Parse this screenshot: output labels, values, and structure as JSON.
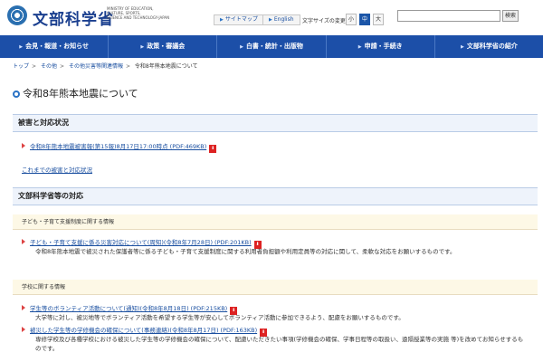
{
  "header": {
    "logo_text": "文部科学省",
    "logo_sub": [
      "MINISTRY OF EDUCATION,",
      "CULTURE, SPORTS,",
      "SCIENCE AND TECHNOLOGY-JAPAN"
    ],
    "sitemap_label": "サイトマップ",
    "english_label": "English",
    "font_size_label": "文字サイズの変更",
    "font_small": "小",
    "font_medium": "中",
    "font_large": "大",
    "search_placeholder": "",
    "search_button": "検索"
  },
  "nav": {
    "items": [
      "会見・報道・お知らせ",
      "政策・審議会",
      "白書・統計・出版物",
      "申請・手続き",
      "文部科学省の紹介"
    ]
  },
  "breadcrumb": {
    "items": [
      "トップ",
      "その他",
      "その他災害等関連情報",
      "令和8年熊本地震について"
    ]
  },
  "page": {
    "title": "令和8年熊本地震について",
    "section1": {
      "title": "被害と対応状況",
      "link1": "令和8年熊本地震被害報(第15報)8月17日17:00時点 (PDF:469KB)",
      "link2": "これまでの被害と対応状況"
    },
    "section2": {
      "title": "文部科学省等の対応",
      "sub1": {
        "title": "子ども・子育て支援制度に関する情報",
        "link": "子ども・子育て支援に係る災害対応について(周知)(令和8年7月28日) (PDF:201KB)",
        "desc": "令和8年熊本地震で被災された保護者等に係る子ども・子育て支援制度に関する利用者負担額や利用定員等の対応に関して、柔軟な対応をお願いするものです。"
      },
      "sub2": {
        "title": "学校に関する情報",
        "link1": "学生等のボランティア活動について(通知)(令和8年8月18日) (PDF:215KB)",
        "desc1": "大学等に対し、被災地等でボランティア活動を希望する学生等が安心してボランティア活動に参加できるよう、配慮をお願いするものです。",
        "link2": "被災した学生等の学修機会の確保について(事務連絡)(令和8年8月17日) (PDF:163KB)",
        "desc2": "専修学校及び各種学校における被災した学生等の学修機会の確保について、配慮いただきたい事項(学修機会の確保、学事日程等の取扱い、遠隔授業等の実施 等)を改めてお知らせするものです。"
      }
    },
    "pdf_icon": "pdf-icon"
  }
}
